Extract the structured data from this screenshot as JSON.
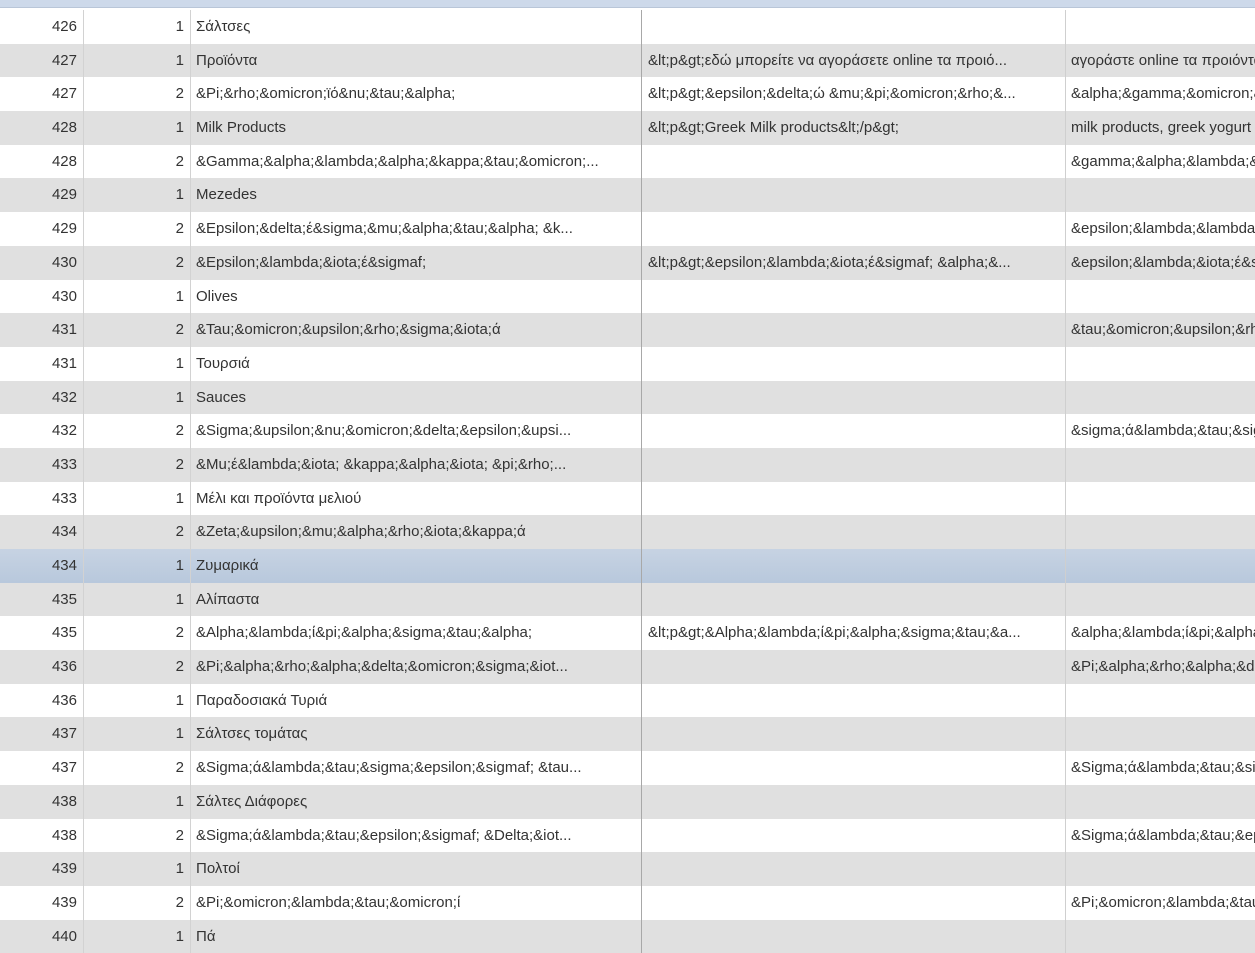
{
  "rows": [
    {
      "id": "426",
      "lang": "1",
      "name": "Σάλτσες",
      "desc": "",
      "meta": ""
    },
    {
      "id": "427",
      "lang": "1",
      "name": "Προϊόντα",
      "desc": "&lt;p&gt;εδώ μπορείτε να αγοράσετε online τα προιό...",
      "meta": "αγοράστε online τα προιόντα"
    },
    {
      "id": "427",
      "lang": "2",
      "name": "&Pi;&rho;&omicron;ϊό&nu;&tau;&alpha;",
      "desc": "&lt;p&gt;&epsilon;&delta;ώ &mu;&pi;&omicron;&rho;&...",
      "meta": "&alpha;&gamma;&omicron;&rho;"
    },
    {
      "id": "428",
      "lang": "1",
      "name": "Milk Products",
      "desc": "&lt;p&gt;Greek Milk products&lt;/p&gt;",
      "meta": "milk products, greek yogurt"
    },
    {
      "id": "428",
      "lang": "2",
      "name": "&Gamma;&alpha;&lambda;&alpha;&kappa;&tau;&omicron;...",
      "desc": "",
      "meta": "&gamma;&alpha;&lambda;&alpha;"
    },
    {
      "id": "429",
      "lang": "1",
      "name": "Mezedes",
      "desc": "",
      "meta": ""
    },
    {
      "id": "429",
      "lang": "2",
      "name": "&Epsilon;&delta;έ&sigma;&mu;&alpha;&tau;&alpha; &k...",
      "desc": "",
      "meta": "&epsilon;&lambda;&lambda;&eta;"
    },
    {
      "id": "430",
      "lang": "2",
      "name": "&Epsilon;&lambda;&iota;έ&sigmaf;",
      "desc": "&lt;p&gt;&epsilon;&lambda;&iota;έ&sigmaf; &alpha;&...",
      "meta": "&epsilon;&lambda;&iota;έ&sigmaf;"
    },
    {
      "id": "430",
      "lang": "1",
      "name": "Olives",
      "desc": "",
      "meta": ""
    },
    {
      "id": "431",
      "lang": "2",
      "name": "&Tau;&omicron;&upsilon;&rho;&sigma;&iota;ά",
      "desc": "",
      "meta": "&tau;&omicron;&upsilon;&rho;&sigma;"
    },
    {
      "id": "431",
      "lang": "1",
      "name": "Τουρσιά",
      "desc": "",
      "meta": ""
    },
    {
      "id": "432",
      "lang": "1",
      "name": "Sauces",
      "desc": "",
      "meta": ""
    },
    {
      "id": "432",
      "lang": "2",
      "name": "&Sigma;&upsilon;&nu;&omicron;&delta;&epsilon;&upsi...",
      "desc": "",
      "meta": "&sigma;ά&lambda;&tau;&sigma;"
    },
    {
      "id": "433",
      "lang": "2",
      "name": "&Mu;έ&lambda;&iota; &kappa;&alpha;&iota; &pi;&rho;...",
      "desc": "",
      "meta": ""
    },
    {
      "id": "433",
      "lang": "1",
      "name": "Μέλι και προϊόντα μελιού",
      "desc": "",
      "meta": ""
    },
    {
      "id": "434",
      "lang": "2",
      "name": "&Zeta;&upsilon;&mu;&alpha;&rho;&iota;&kappa;ά",
      "desc": "",
      "meta": ""
    },
    {
      "id": "434",
      "lang": "1",
      "name": "Ζυμαρικά",
      "desc": "",
      "meta": "",
      "selected": true
    },
    {
      "id": "435",
      "lang": "1",
      "name": "Αλίπαστα",
      "desc": "",
      "meta": ""
    },
    {
      "id": "435",
      "lang": "2",
      "name": "&Alpha;&lambda;ί&pi;&alpha;&sigma;&tau;&alpha;",
      "desc": "&lt;p&gt;&Alpha;&lambda;ί&pi;&alpha;&sigma;&tau;&a...",
      "meta": "&alpha;&lambda;ί&pi;&alpha;&sigma;"
    },
    {
      "id": "436",
      "lang": "2",
      "name": "&Pi;&alpha;&rho;&alpha;&delta;&omicron;&sigma;&iot...",
      "desc": "",
      "meta": "&Pi;&alpha;&rho;&alpha;&delta;"
    },
    {
      "id": "436",
      "lang": "1",
      "name": "Παραδοσιακά Τυριά",
      "desc": "",
      "meta": ""
    },
    {
      "id": "437",
      "lang": "1",
      "name": "Σάλτσες τομάτας",
      "desc": "",
      "meta": ""
    },
    {
      "id": "437",
      "lang": "2",
      "name": "&Sigma;ά&lambda;&tau;&sigma;&epsilon;&sigmaf; &tau...",
      "desc": "",
      "meta": "&Sigma;ά&lambda;&tau;&sigma;"
    },
    {
      "id": "438",
      "lang": "1",
      "name": "Σάλτες Διάφορες",
      "desc": "",
      "meta": ""
    },
    {
      "id": "438",
      "lang": "2",
      "name": "&Sigma;ά&lambda;&tau;&epsilon;&sigmaf; &Delta;&iot...",
      "desc": "",
      "meta": "&Sigma;ά&lambda;&tau;&epsilon;"
    },
    {
      "id": "439",
      "lang": "1",
      "name": "Πολτοί",
      "desc": "",
      "meta": ""
    },
    {
      "id": "439",
      "lang": "2",
      "name": "&Pi;&omicron;&lambda;&tau;&omicron;ί",
      "desc": "",
      "meta": "&Pi;&omicron;&lambda;&tau;&omicron;ί"
    },
    {
      "id": "440",
      "lang": "1",
      "name": "Πά",
      "desc": "",
      "meta": ""
    }
  ]
}
